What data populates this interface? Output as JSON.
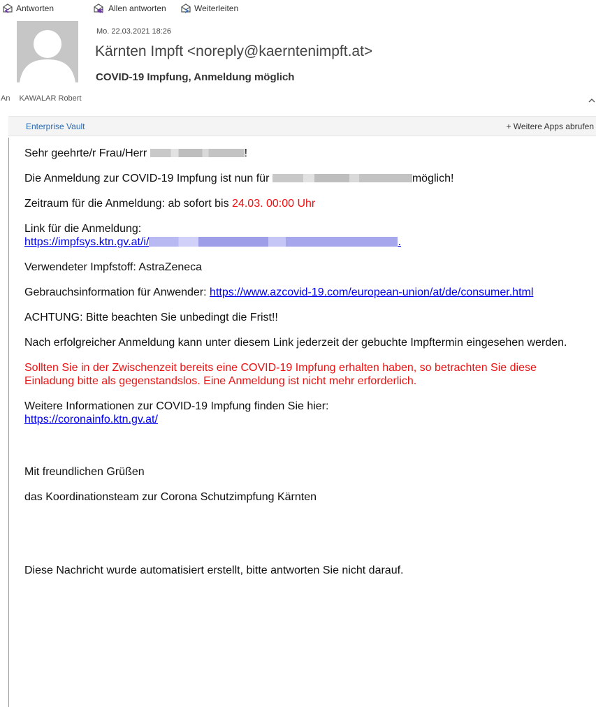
{
  "toolbar": {
    "reply": "Antworten",
    "reply_all": "Allen antworten",
    "forward": "Weiterleiten"
  },
  "header": {
    "date": "Mo. 22.03.2021 18:26",
    "sender": "Kärnten Impft <noreply@kaerntenimpft.at>",
    "subject": "COVID-19 Impfung, Anmeldung möglich",
    "to_label": "An",
    "to_value": "KAWALAR Robert"
  },
  "apps_bar": {
    "enterprise_vault": "Enterprise Vault",
    "more_apps": "+ Weitere Apps abrufen"
  },
  "body": {
    "greeting_start": "Sehr geehrte/r Frau/Herr",
    "greeting_end": "!",
    "registration_start": "Die Anmeldung zur COVID-19 Impfung ist nun für",
    "registration_end": "möglich!",
    "period_label": "Zeitraum für die Anmeldung: ab sofort bis",
    "period_deadline": "24.03. 00:00 Uhr",
    "link_label": "Link für die Anmeldung:",
    "link_url": "https://impfsys.ktn.gv.at/i/",
    "link_end": ".",
    "vaccine": "Verwendeter Impfstoff: AstraZeneca",
    "info_label": "Gebrauchsinformation für Anwender:",
    "info_url": "https://www.azcovid-19.com/european-union/at/de/consumer.html",
    "warning": "ACHTUNG: Bitte beachten Sie unbedingt die Frist!!",
    "after_registration": "Nach erfolgreicher Anmeldung kann unter diesem Link jederzeit der gebuchte Impftermin eingesehen werden.",
    "red_notice": "Sollten Sie in der Zwischenzeit bereits eine COVID-19 Impfung erhalten haben, so betrachten Sie diese Einladung bitte als gegenstandslos. Eine Anmeldung ist nicht mehr erforderlich.",
    "more_info_label": "Weitere Informationen zur COVID-19 Impfung finden Sie hier:",
    "more_info_url": "https://coronainfo.ktn.gv.at/",
    "closing": "Mit freundlichen Grüßen",
    "signature": "das Koordinationsteam zur Corona Schutzimpfung Kärnten",
    "auto_notice": "Diese Nachricht wurde automatisiert erstellt, bitte antworten Sie nicht darauf."
  },
  "colors": {
    "link": "#0000ee",
    "red": "#ee1111",
    "accent_blue": "#2a6ab3"
  },
  "icons": [
    "reply-icon",
    "reply-all-icon",
    "forward-icon",
    "avatar-placeholder-icon",
    "chevron-up-icon"
  ]
}
